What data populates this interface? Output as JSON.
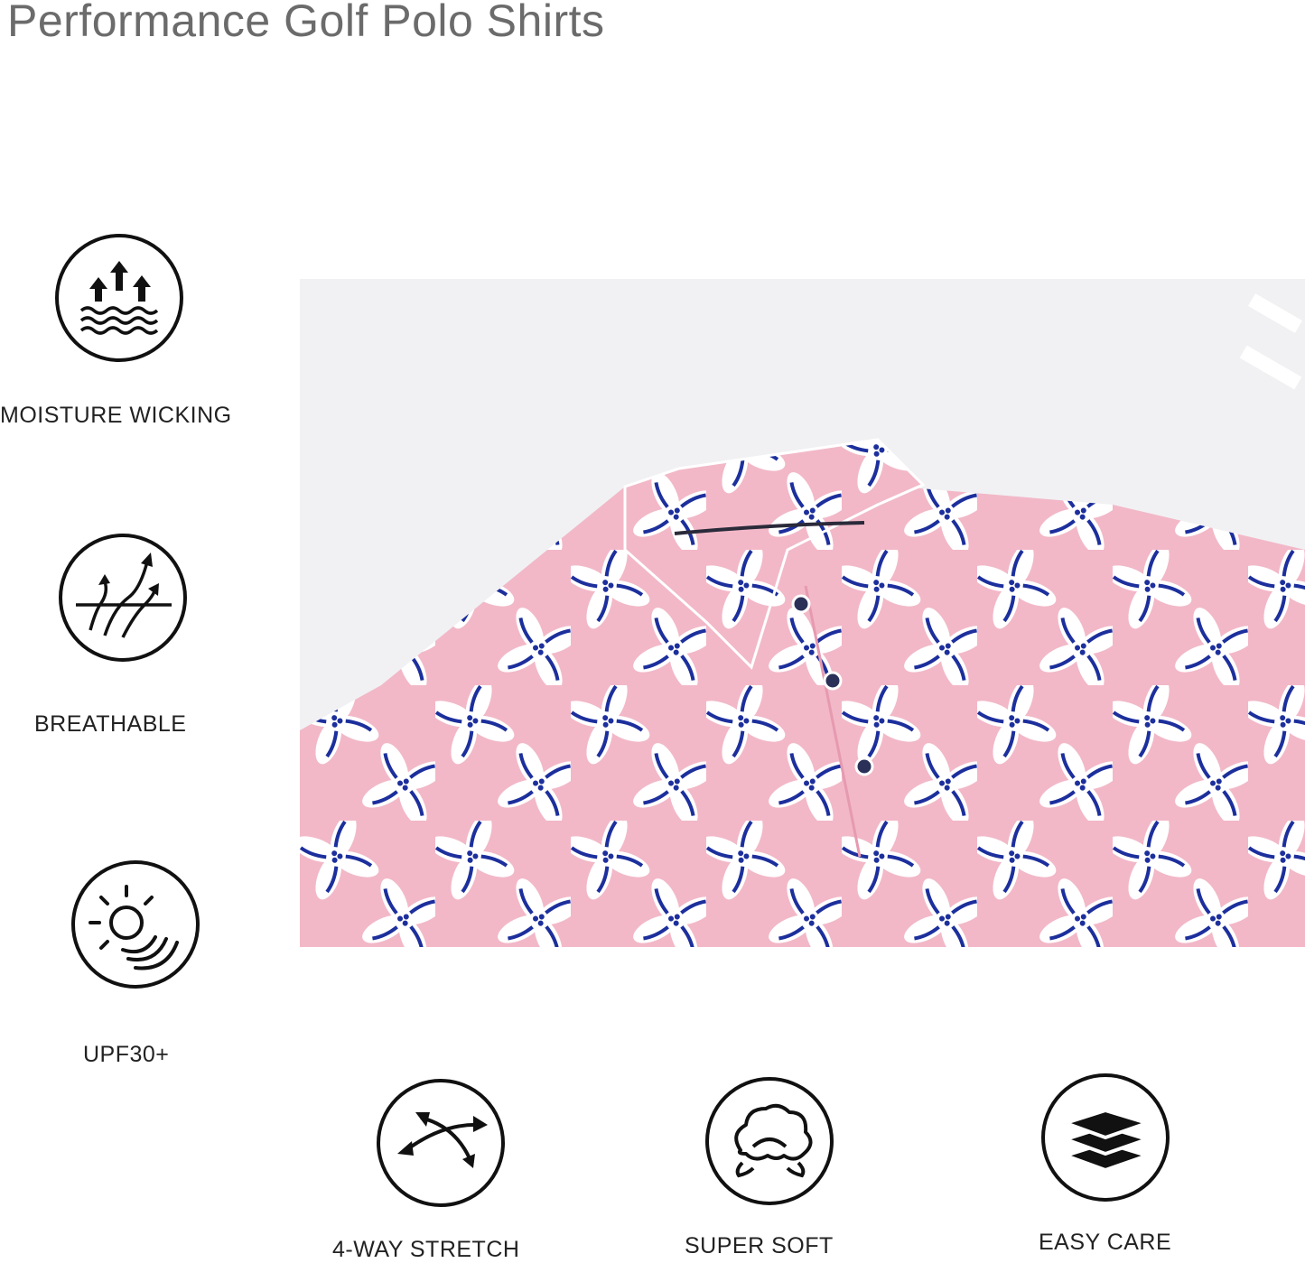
{
  "page": {
    "title": "Performance Golf Polo Shirts"
  },
  "features": [
    {
      "label": "MOISTURE WICKING",
      "icon": "moisture-wicking-icon"
    },
    {
      "label": "BREATHABLE",
      "icon": "breathable-icon"
    },
    {
      "label": "UPF30+",
      "icon": "sun-protection-icon"
    },
    {
      "label": "4-WAY STRETCH",
      "icon": "stretch-arrows-icon"
    },
    {
      "label": "SUPER SOFT",
      "icon": "cotton-soft-icon"
    },
    {
      "label": "EASY CARE",
      "icon": "stacked-layers-icon"
    }
  ],
  "product_photo": {
    "subject": "pink floral polo shirt",
    "colors": {
      "fabric": "#f2b8c8",
      "petal": "#ffffff",
      "stripe": "#1c2f9c",
      "background": "#f1f1f3"
    }
  }
}
